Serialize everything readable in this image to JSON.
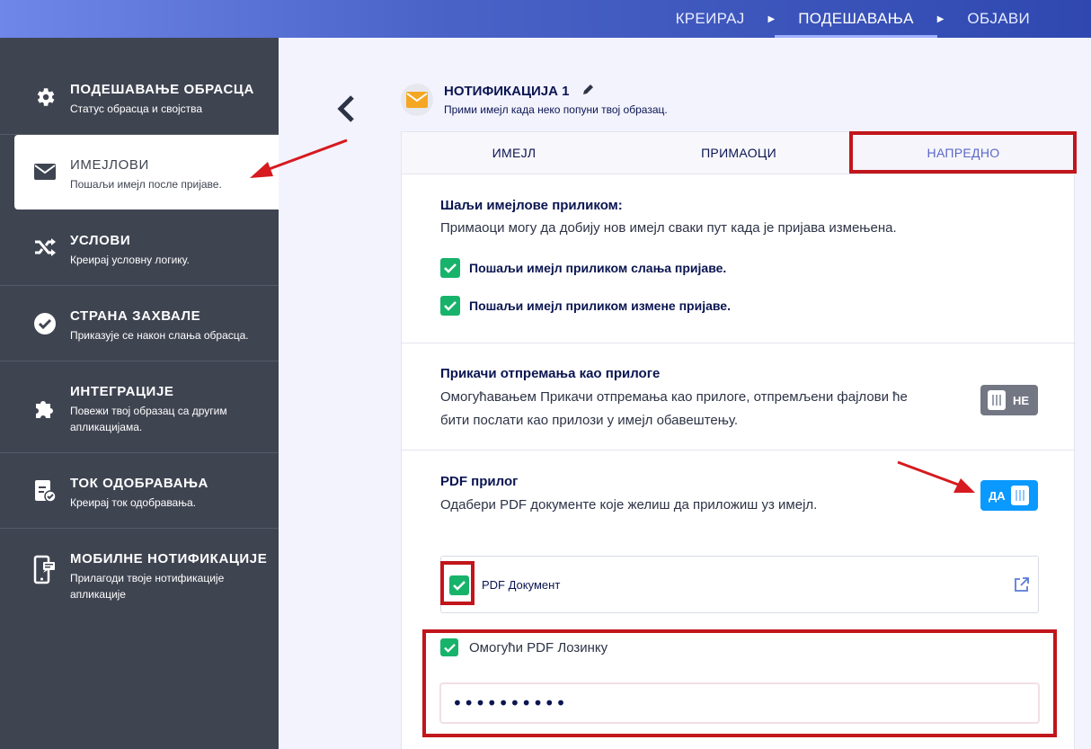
{
  "topnav": {
    "items": [
      "КРЕИРАЈ",
      "ПОДЕШАВАЊА",
      "ОБЈАВИ"
    ],
    "active": "ПОДЕШАВАЊА"
  },
  "sidebar": {
    "items": [
      {
        "title": "ПОДЕШАВАЊЕ ОБРАСЦА",
        "desc": "Статус обрасца и својства",
        "icon": "gear-icon"
      },
      {
        "title": "ИМЕЈЛОВИ",
        "desc": "Пошаљи имејл после пријаве.",
        "icon": "envelope-icon"
      },
      {
        "title": "УСЛОВИ",
        "desc": "Креирај условну логику.",
        "icon": "shuffle-icon"
      },
      {
        "title": "СТРАНА ЗАХВАЛЕ",
        "desc": "Приказује се након слања обрасца.",
        "icon": "check-circle-icon"
      },
      {
        "title": "ИНТЕГРАЦИЈЕ",
        "desc": "Повежи твој образац са другим апликацијама.",
        "icon": "puzzle-icon"
      },
      {
        "title": "ТОК ОДОБРАВАЊА",
        "desc": "Креирај ток одобравања.",
        "icon": "approval-icon"
      },
      {
        "title": "МОБИЛНЕ НОТИФИКАЦИЈЕ",
        "desc": "Прилагоди твоје нотификације апликације",
        "icon": "mobile-icon"
      }
    ],
    "active_index": 1
  },
  "header": {
    "title": "НОТИФИКАЦИЈА 1",
    "subtitle": "Прими имејл када неко попуни твој образац."
  },
  "tabs": [
    "ИМЕЈЛ",
    "ПРИМАОЦИ",
    "НАПРЕДНО"
  ],
  "send_when": {
    "title": "Шаљи имејлове приликом:",
    "text": "Примаоци могу да добију нов имејл сваки пут када је пријава измењена.",
    "opt1": "Пошаљи имејл приликом слања пријаве.",
    "opt2": "Пошаљи имејл приликом измене пријаве."
  },
  "attach": {
    "title": "Прикачи отпремања као прилоге",
    "text1": "Омогућавањем Прикачи отпремања као прилоге, отпремљени фајлови ће",
    "text2": "бити послати као прилози у имејл обавештењу.",
    "toggle": "НЕ"
  },
  "pdf": {
    "title": "PDF прилог",
    "text": "Одабери PDF документе које желиш да приложиш уз имејл.",
    "toggle": "ДА",
    "document": "PDF Документ",
    "password_label": "Омогући PDF Лозинку",
    "password_value": "••••••••••"
  },
  "colors": {
    "accent": "#0a99ff",
    "check": "#18b36b",
    "highlight": "#c0161c",
    "sidebar": "#3f4451"
  }
}
